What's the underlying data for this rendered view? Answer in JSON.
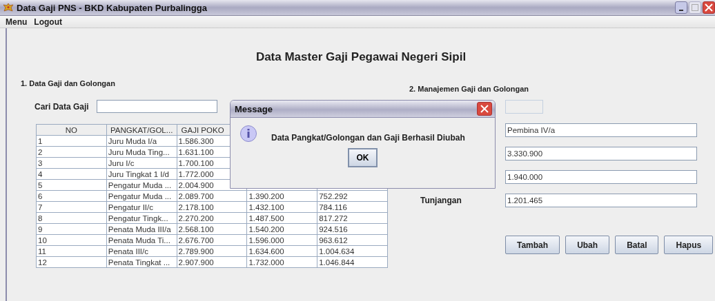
{
  "window": {
    "title": "Data Gaji PNS - BKD Kabupaten Purbalingga"
  },
  "menu": [
    {
      "label": "Menu"
    },
    {
      "label": "Logout"
    }
  ],
  "heading": "Data Master Gaji Pegawai Negeri Sipil",
  "left_panel": {
    "title": "1. Data Gaji dan Golongan",
    "search_label": "Cari Data Gaji",
    "table": {
      "columns": [
        "NO",
        "PANGKAT/GOL...",
        "GAJI POKO"
      ],
      "rows": [
        [
          "1",
          "Juru Muda I/a",
          "1.586.300"
        ],
        [
          "2",
          "Juru Muda Ting...",
          "1.631.100"
        ],
        [
          "3",
          "Juru I/c",
          "1.700.100"
        ],
        [
          "4",
          "Juru Tingkat 1 I/d",
          "1.772.000"
        ],
        [
          "5",
          "Pengatur Muda ...",
          "2.004.900"
        ],
        [
          "6",
          "Pengatur Muda ...",
          "2.089.700",
          "1.390.200",
          "752.292"
        ],
        [
          "7",
          "Pengatur II/c",
          "2.178.100",
          "1.432.100",
          "784.116"
        ],
        [
          "8",
          "Pengatur Tingk...",
          "2.270.200",
          "1.487.500",
          "817.272"
        ],
        [
          "9",
          "Penata Muda III/a",
          "2.568.100",
          "1.540.200",
          "924.516"
        ],
        [
          "10",
          "Penata Muda Ti...",
          "2.676.700",
          "1.596.000",
          "963.612"
        ],
        [
          "11",
          "Penata III/c",
          "2.789.900",
          "1.634.600",
          "1.004.634"
        ],
        [
          "12",
          "Penata Tingkat ...",
          "2.907.900",
          "1.732.000",
          "1.046.844"
        ]
      ]
    }
  },
  "right_panel": {
    "title": "2. Manajemen Gaji dan Golongan",
    "fields": [
      {
        "value": "Pembina IV/a"
      },
      {
        "value": "3.330.900"
      },
      {
        "value": "1.940.000"
      },
      {
        "label": "Tunjangan",
        "value": "1.201.465"
      }
    ],
    "buttons": [
      "Tambah",
      "Ubah",
      "Batal",
      "Hapus"
    ]
  },
  "dialog": {
    "title": "Message",
    "message": "Data Pangkat/Golongan dan Gaji Berhasil Diubah",
    "button": "OK"
  }
}
